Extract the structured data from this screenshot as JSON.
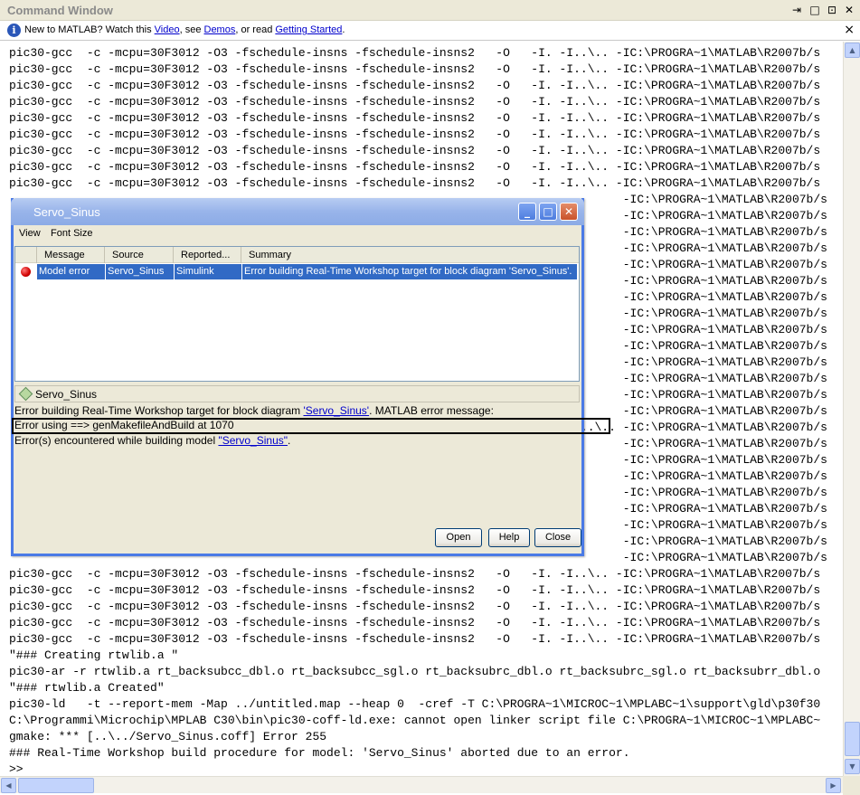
{
  "command_window": {
    "title": "Command Window",
    "controls": {
      "undock": "⇥",
      "restore": "□",
      "maximize": "⊡",
      "close": "✕"
    }
  },
  "info_bar": {
    "prefix": "New to MATLAB? Watch this ",
    "video_link": "Video",
    "mid1": ", see ",
    "demos_link": "Demos",
    "mid2": ", or read ",
    "getting_started_link": "Getting Started",
    "suffix": ".",
    "close": "×"
  },
  "console": {
    "lines": [
      "pic30-gcc  -c -mcpu=30F3012 -O3 -fschedule-insns -fschedule-insns2   -O   -I. -I..\\.. -IC:\\PROGRA~1\\MATLAB\\R2007b/s",
      "pic30-gcc  -c -mcpu=30F3012 -O3 -fschedule-insns -fschedule-insns2   -O   -I. -I..\\.. -IC:\\PROGRA~1\\MATLAB\\R2007b/s",
      "pic30-gcc  -c -mcpu=30F3012 -O3 -fschedule-insns -fschedule-insns2   -O   -I. -I..\\.. -IC:\\PROGRA~1\\MATLAB\\R2007b/s",
      "pic30-gcc  -c -mcpu=30F3012 -O3 -fschedule-insns -fschedule-insns2   -O   -I. -I..\\.. -IC:\\PROGRA~1\\MATLAB\\R2007b/s",
      "pic30-gcc  -c -mcpu=30F3012 -O3 -fschedule-insns -fschedule-insns2   -O   -I. -I..\\.. -IC:\\PROGRA~1\\MATLAB\\R2007b/s",
      "pic30-gcc  -c -mcpu=30F3012 -O3 -fschedule-insns -fschedule-insns2   -O   -I. -I..\\.. -IC:\\PROGRA~1\\MATLAB\\R2007b/s",
      "pic30-gcc  -c -mcpu=30F3012 -O3 -fschedule-insns -fschedule-insns2   -O   -I. -I..\\.. -IC:\\PROGRA~1\\MATLAB\\R2007b/s",
      "pic30-gcc  -c -mcpu=30F3012 -O3 -fschedule-insns -fschedule-insns2   -O   -I. -I..\\.. -IC:\\PROGRA~1\\MATLAB\\R2007b/s",
      "pic30-gcc  -c -mcpu=30F3012 -O3 -fschedule-insns -fschedule-insns2   -O   -I. -I..\\.. -IC:\\PROGRA~1\\MATLAB\\R2007b/s",
      "                                                                                       -IC:\\PROGRA~1\\MATLAB\\R2007b/s",
      "                                                                                       -IC:\\PROGRA~1\\MATLAB\\R2007b/s",
      "                                                                                       -IC:\\PROGRA~1\\MATLAB\\R2007b/s",
      "                                                                                       -IC:\\PROGRA~1\\MATLAB\\R2007b/s",
      "                                                                                       -IC:\\PROGRA~1\\MATLAB\\R2007b/s",
      "                                                                                       -IC:\\PROGRA~1\\MATLAB\\R2007b/s",
      "                                                                                       -IC:\\PROGRA~1\\MATLAB\\R2007b/s",
      "                                                                                       -IC:\\PROGRA~1\\MATLAB\\R2007b/s",
      "                                                                                       -IC:\\PROGRA~1\\MATLAB\\R2007b/s",
      "                                                                                       -IC:\\PROGRA~1\\MATLAB\\R2007b/s",
      "                                                                                       -IC:\\PROGRA~1\\MATLAB\\R2007b/s",
      "                                                                                       -IC:\\PROGRA~1\\MATLAB\\R2007b/s",
      "                                                                                       -IC:\\PROGRA~1\\MATLAB\\R2007b/s",
      "                                                                                       -IC:\\PROGRA~1\\MATLAB\\R2007b/s",
      "                                                                                 ..\\.. -IC:\\PROGRA~1\\MATLAB\\R2007b/s",
      "                                                                                       -IC:\\PROGRA~1\\MATLAB\\R2007b/s",
      "                                                                                       -IC:\\PROGRA~1\\MATLAB\\R2007b/s",
      "                                                                                       -IC:\\PROGRA~1\\MATLAB\\R2007b/s",
      "                                                                                       -IC:\\PROGRA~1\\MATLAB\\R2007b/s",
      "                                                                                       -IC:\\PROGRA~1\\MATLAB\\R2007b/s",
      "                                                                                       -IC:\\PROGRA~1\\MATLAB\\R2007b/s",
      "                                                                                       -IC:\\PROGRA~1\\MATLAB\\R2007b/s",
      "                                                                                       -IC:\\PROGRA~1\\MATLAB\\R2007b/s",
      "pic30-gcc  -c -mcpu=30F3012 -O3 -fschedule-insns -fschedule-insns2   -O   -I. -I..\\.. -IC:\\PROGRA~1\\MATLAB\\R2007b/s",
      "pic30-gcc  -c -mcpu=30F3012 -O3 -fschedule-insns -fschedule-insns2   -O   -I. -I..\\.. -IC:\\PROGRA~1\\MATLAB\\R2007b/s",
      "pic30-gcc  -c -mcpu=30F3012 -O3 -fschedule-insns -fschedule-insns2   -O   -I. -I..\\.. -IC:\\PROGRA~1\\MATLAB\\R2007b/s",
      "pic30-gcc  -c -mcpu=30F3012 -O3 -fschedule-insns -fschedule-insns2   -O   -I. -I..\\.. -IC:\\PROGRA~1\\MATLAB\\R2007b/s",
      "pic30-gcc  -c -mcpu=30F3012 -O3 -fschedule-insns -fschedule-insns2   -O   -I. -I..\\.. -IC:\\PROGRA~1\\MATLAB\\R2007b/s",
      "\"### Creating rtwlib.a \"",
      "pic30-ar -r rtwlib.a rt_backsubcc_dbl.o rt_backsubcc_sgl.o rt_backsubrc_dbl.o rt_backsubrc_sgl.o rt_backsubrr_dbl.o",
      "\"### rtwlib.a Created\"",
      "pic30-ld   -t --report-mem -Map ../untitled.map --heap 0  -cref -T C:\\PROGRA~1\\MICROC~1\\MPLABC~1\\support\\gld\\p30f30",
      "C:\\Programmi\\Microchip\\MPLAB C30\\bin\\pic30-coff-ld.exe: cannot open linker script file C:\\PROGRA~1\\MICROC~1\\MPLABC~",
      "gmake: *** [..\\../Servo_Sinus.coff] Error 255",
      "### Real-Time Workshop build procedure for model: 'Servo_Sinus' aborted due to an error.",
      ">> "
    ]
  },
  "dialog": {
    "title": "Servo_Sinus",
    "menu": [
      "View",
      "Font Size"
    ],
    "columns": [
      "Message",
      "Source",
      "Reported...",
      "Summary"
    ],
    "rows": [
      {
        "message": "Model error",
        "source": "Servo_Sinus",
        "reported": "Simulink",
        "summary": "Error building Real-Time Workshop target for block diagram 'Servo_Sinus'."
      }
    ],
    "detail_title": "Servo_Sinus",
    "detail": {
      "line1_prefix": "Error building Real-Time Workshop target for block diagram ",
      "line1_link": "'Servo_Sinus'",
      "line1_suffix": ". MATLAB error message:",
      "line2": "Error using ==> genMakefileAndBuild at 1070",
      "line3_prefix": "Error(s) encountered while building model ",
      "line3_link": "\"Servo_Sinus\"",
      "line3_suffix": "."
    },
    "buttons": {
      "open": "Open",
      "help": "Help",
      "close": "Close"
    }
  },
  "colors": {
    "selection": "#316ac5",
    "dialog_border": "#4a7ae6",
    "link": "#0000cc"
  }
}
